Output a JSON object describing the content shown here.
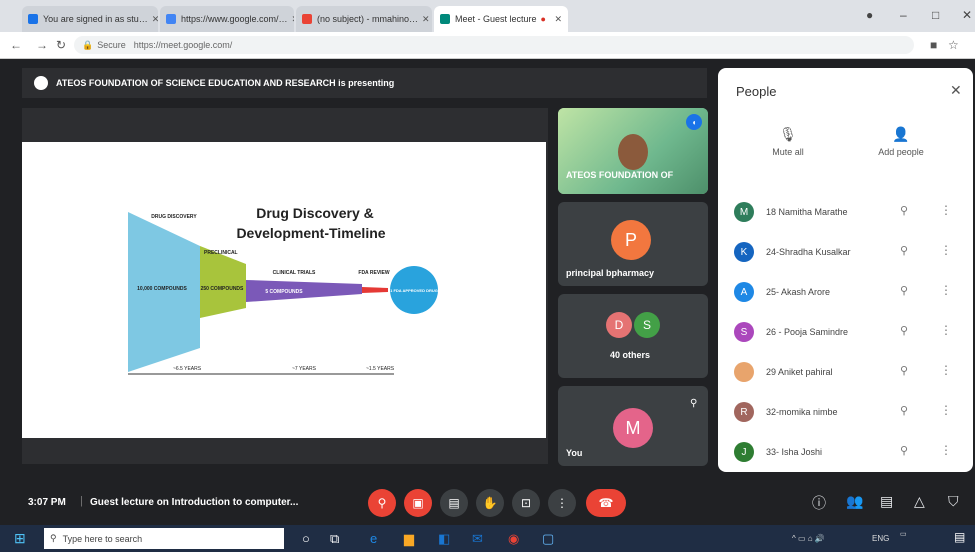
{
  "tabs": [
    {
      "label": "You are signed in as stu…",
      "color": "#1a73e8"
    },
    {
      "label": "https://www.google.com/…",
      "color": "#4285f4"
    },
    {
      "label": "(no subject) - mmahino…",
      "color": "#ea4335"
    },
    {
      "label": "Meet - Guest lecture",
      "color": "#00897b"
    }
  ],
  "address": {
    "secure": "Secure",
    "url": "https://meet.google.com/"
  },
  "presenting_banner": "ATEOS FOUNDATION OF SCIENCE EDUCATION AND RESEARCH is presenting",
  "slide": {
    "title_line1": "Drug Discovery &",
    "title_line2": "Development-Timeline",
    "stage_labels": [
      "DRUG DISCOVERY",
      "PRECLINICAL",
      "CLINICAL TRIALS",
      "FDA REVIEW"
    ],
    "inner_labels": [
      "10,000 COMPOUNDS",
      "250 COMPOUNDS",
      "5 COMPOUNDS",
      "1 FDA APPROVED DRUG"
    ],
    "durations": [
      "~6.5 YEARS",
      "~7 YEARS",
      "~1.5 YEARS"
    ]
  },
  "tiles": {
    "presenter_name": "ATEOS FOUNDATION OF",
    "principal_initial": "P",
    "principal_name": "principal bpharmacy",
    "others_initials": [
      "D",
      "S"
    ],
    "others_label": "40 others",
    "you_initial": "M",
    "you_label": "You"
  },
  "people": {
    "title": "People",
    "mute_all": "Mute all",
    "add_people": "Add people",
    "list": [
      {
        "initial": "M",
        "name": "18 Namitha Marathe",
        "color": "#2e7d5b"
      },
      {
        "initial": "K",
        "name": "24-Shradha Kusalkar",
        "color": "#1565c0"
      },
      {
        "initial": "A",
        "name": "25- Akash Arore",
        "color": "#1e88e5"
      },
      {
        "initial": "S",
        "name": "26 - Pooja Samindre",
        "color": "#ab47bc"
      },
      {
        "initial": "",
        "name": "29 Aniket pahiral",
        "color": "#e8a46c"
      },
      {
        "initial": "R",
        "name": "32-momika nimbe",
        "color": "#a1665e"
      },
      {
        "initial": "J",
        "name": "33- Isha Joshi",
        "color": "#2e7d32"
      }
    ]
  },
  "bottom": {
    "time": "3:07 PM",
    "meeting": "Guest lecture on Introduction to computer..."
  },
  "taskbar": {
    "search_placeholder": "Type here to search",
    "lang": "ENG"
  }
}
